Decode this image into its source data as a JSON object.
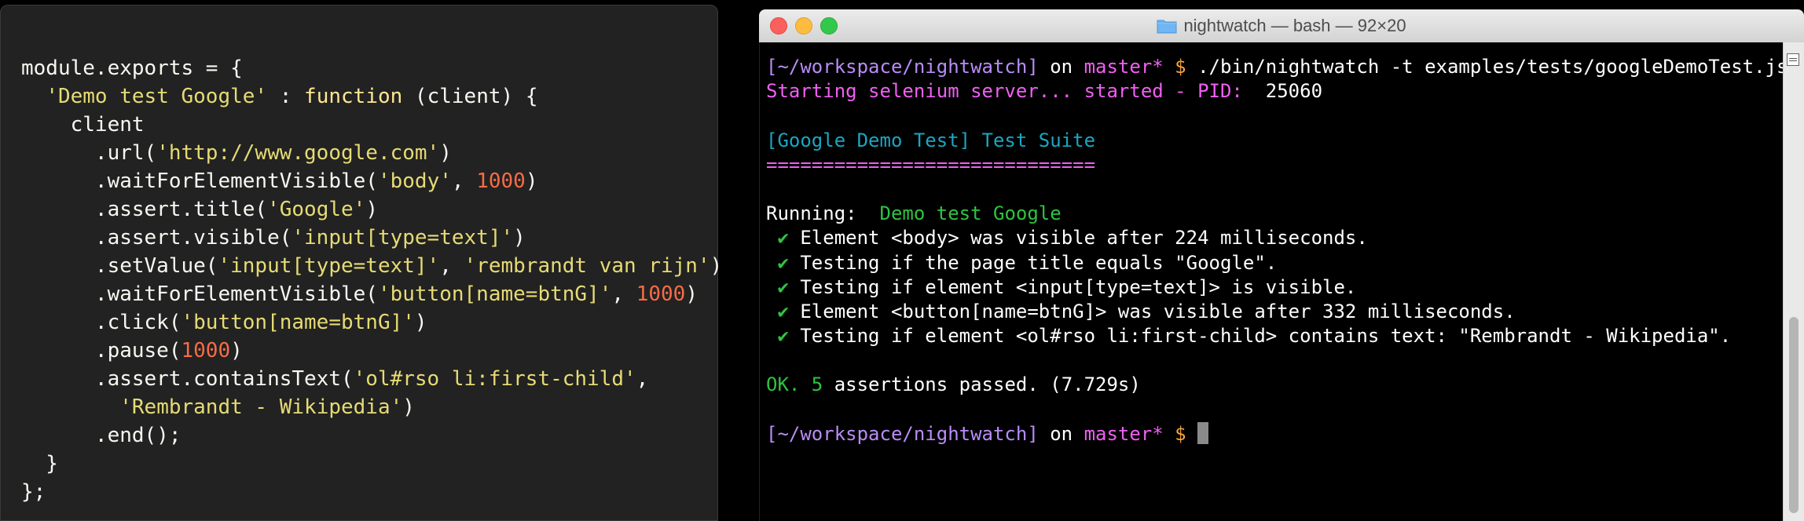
{
  "editor": {
    "lines": [
      [
        {
          "t": "module.exports = {",
          "c": "t-plain"
        }
      ],
      [
        {
          "t": "  ",
          "c": "t-plain"
        },
        {
          "t": "'Demo test Google'",
          "c": "t-str"
        },
        {
          "t": " : ",
          "c": "t-plain"
        },
        {
          "t": "function",
          "c": "t-kw"
        },
        {
          "t": " (client) {",
          "c": "t-plain"
        }
      ],
      [
        {
          "t": "    client",
          "c": "t-plain"
        }
      ],
      [
        {
          "t": "      .url(",
          "c": "t-plain"
        },
        {
          "t": "'http://www.google.com'",
          "c": "t-str"
        },
        {
          "t": ")",
          "c": "t-plain"
        }
      ],
      [
        {
          "t": "      .waitForElementVisible(",
          "c": "t-plain"
        },
        {
          "t": "'body'",
          "c": "t-str"
        },
        {
          "t": ", ",
          "c": "t-plain"
        },
        {
          "t": "1000",
          "c": "t-num"
        },
        {
          "t": ")",
          "c": "t-plain"
        }
      ],
      [
        {
          "t": "      .assert.title(",
          "c": "t-plain"
        },
        {
          "t": "'Google'",
          "c": "t-str"
        },
        {
          "t": ")",
          "c": "t-plain"
        }
      ],
      [
        {
          "t": "      .assert.visible(",
          "c": "t-plain"
        },
        {
          "t": "'input[type=text]'",
          "c": "t-str"
        },
        {
          "t": ")",
          "c": "t-plain"
        }
      ],
      [
        {
          "t": "      .setValue(",
          "c": "t-plain"
        },
        {
          "t": "'input[type=text]'",
          "c": "t-str"
        },
        {
          "t": ", ",
          "c": "t-plain"
        },
        {
          "t": "'rembrandt van rijn'",
          "c": "t-str"
        },
        {
          "t": ")",
          "c": "t-plain"
        }
      ],
      [
        {
          "t": "      .waitForElementVisible(",
          "c": "t-plain"
        },
        {
          "t": "'button[name=btnG]'",
          "c": "t-str"
        },
        {
          "t": ", ",
          "c": "t-plain"
        },
        {
          "t": "1000",
          "c": "t-num"
        },
        {
          "t": ")",
          "c": "t-plain"
        }
      ],
      [
        {
          "t": "      .click(",
          "c": "t-plain"
        },
        {
          "t": "'button[name=btnG]'",
          "c": "t-str"
        },
        {
          "t": ")",
          "c": "t-plain"
        }
      ],
      [
        {
          "t": "      .pause(",
          "c": "t-plain"
        },
        {
          "t": "1000",
          "c": "t-num"
        },
        {
          "t": ")",
          "c": "t-plain"
        }
      ],
      [
        {
          "t": "      .assert.containsText(",
          "c": "t-plain"
        },
        {
          "t": "'ol#rso li:first-child'",
          "c": "t-str"
        },
        {
          "t": ",",
          "c": "t-plain"
        }
      ],
      [
        {
          "t": "        ",
          "c": "t-plain"
        },
        {
          "t": "'Rembrandt - Wikipedia'",
          "c": "t-str"
        },
        {
          "t": ")",
          "c": "t-plain"
        }
      ],
      [
        {
          "t": "      .end();",
          "c": "t-plain"
        }
      ],
      [
        {
          "t": "  }",
          "c": "t-plain"
        }
      ],
      [
        {
          "t": "};",
          "c": "t-plain"
        }
      ]
    ]
  },
  "terminal": {
    "title": "nightwatch — bash — 92×20",
    "icons": {
      "folder": "folder-icon",
      "scroll_menu": "menu-icon"
    },
    "lines": [
      [
        {
          "t": "[~/workspace/nightwatch]",
          "c": "c-purple"
        },
        {
          "t": " on ",
          "c": "c-white"
        },
        {
          "t": "master*",
          "c": "c-magenta"
        },
        {
          "t": " $ ",
          "c": "c-orange"
        },
        {
          "t": "./bin/nightwatch -t examples/tests/googleDemoTest.js",
          "c": "c-white"
        }
      ],
      [
        {
          "t": "Starting selenium server... started - PID:  ",
          "c": "c-magenta"
        },
        {
          "t": "25060",
          "c": "c-white"
        }
      ],
      [],
      [
        {
          "t": "[Google Demo Test] Test Suite",
          "c": "c-cyan"
        }
      ],
      [
        {
          "t": "=============================",
          "c": "c-magenta"
        }
      ],
      [],
      [
        {
          "t": "Running:  ",
          "c": "c-white"
        },
        {
          "t": "Demo test Google",
          "c": "c-green"
        }
      ],
      [
        {
          "t": " ✔",
          "c": "c-green"
        },
        {
          "t": " Element <body> was visible after 224 milliseconds.",
          "c": "c-white"
        }
      ],
      [
        {
          "t": " ✔",
          "c": "c-green"
        },
        {
          "t": " Testing if the page title equals \"Google\".",
          "c": "c-white"
        }
      ],
      [
        {
          "t": " ✔",
          "c": "c-green"
        },
        {
          "t": " Testing if element <input[type=text]> is visible.",
          "c": "c-white"
        }
      ],
      [
        {
          "t": " ✔",
          "c": "c-green"
        },
        {
          "t": " Element <button[name=btnG]> was visible after 332 milliseconds.",
          "c": "c-white"
        }
      ],
      [
        {
          "t": " ✔",
          "c": "c-green"
        },
        {
          "t": " Testing if element <ol#rso li:first-child> contains text: \"Rembrandt - Wikipedia\".",
          "c": "c-white"
        }
      ],
      [],
      [
        {
          "t": "OK. 5 ",
          "c": "c-green"
        },
        {
          "t": "assertions passed. (7.729s)",
          "c": "c-white"
        }
      ],
      [],
      [
        {
          "t": "[~/workspace/nightwatch]",
          "c": "c-purple"
        },
        {
          "t": " on ",
          "c": "c-white"
        },
        {
          "t": "master*",
          "c": "c-magenta"
        },
        {
          "t": " $ ",
          "c": "c-orange"
        }
      ]
    ],
    "cursor_line": 15
  },
  "colors": {
    "editor_bg": "#222222",
    "string": "#e6db74",
    "number": "#f76c45",
    "keyword": "#ffe792",
    "prompt_path": "#b88cf6",
    "branch": "#f05ff2",
    "success": "#2dc440",
    "suite": "#1aa6c1"
  }
}
